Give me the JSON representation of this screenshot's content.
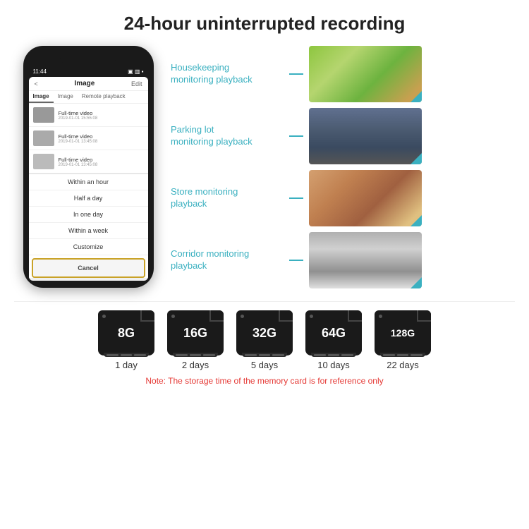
{
  "title": "24-hour uninterrupted recording",
  "monitoring": {
    "items": [
      {
        "label": "Housekeeping\nmonitoring playback",
        "imgClass": "img-kids"
      },
      {
        "label": "Parking lot\nmonitoring playback",
        "imgClass": "img-parking"
      },
      {
        "label": "Store monitoring\nplayback",
        "imgClass": "img-store"
      },
      {
        "label": "Corridor monitoring\nplayback",
        "imgClass": "img-corridor"
      }
    ]
  },
  "phone": {
    "time": "11:44",
    "header_title": "Image",
    "header_left": "<",
    "header_right": "Edit",
    "tabs": [
      "Image",
      "Image",
      "Remote playback"
    ],
    "list_items": [
      {
        "title": "Full-time video",
        "date": "2019-01-01 15:55:08"
      },
      {
        "title": "Full-time video",
        "date": "2019-01-01 13:45:08"
      },
      {
        "title": "Full-time video",
        "date": "2019-01-01 13:45:08"
      }
    ],
    "dropdown_items": [
      "Within an hour",
      "Half a day",
      "In one day",
      "Within a week",
      "Customize"
    ],
    "cancel_label": "Cancel"
  },
  "sdcards": [
    {
      "size": "8G",
      "days": "1 day"
    },
    {
      "size": "16G",
      "days": "2 days"
    },
    {
      "size": "32G",
      "days": "5 days"
    },
    {
      "size": "64G",
      "days": "10 days"
    },
    {
      "size": "128G",
      "days": "22 days"
    }
  ],
  "note": "Note: The storage time of the memory card is for reference only"
}
